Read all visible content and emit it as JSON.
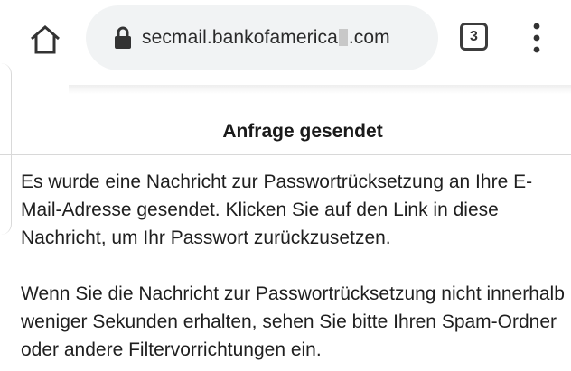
{
  "browser": {
    "url_prefix": "secmail.bankofamerica",
    "url_suffix": ".com",
    "tab_count": "3",
    "icons": {
      "home": "home-icon",
      "lock": "lock-icon",
      "menu": "more-vert-icon"
    }
  },
  "page": {
    "title": "Anfrage gesendet",
    "paragraph1": "Es wurde eine Nachricht zur Passwortrücksetzung an Ihre E-Mail-Adresse gesendet. Klicken Sie auf den Link in diese Nachricht, um Ihr Passwort zurückzusetzen.",
    "paragraph2": "Wenn Sie die Nachricht zur Passwortrücksetzung nicht innerhalb weniger Sekunden erhalten, sehen Sie bitte Ihren Spam-Ordner oder andere Filtervorrichtungen ein."
  },
  "colors": {
    "url_bar_bg": "#f1f3f4",
    "text": "#1f1f1f",
    "divider": "#d8d8d8"
  }
}
